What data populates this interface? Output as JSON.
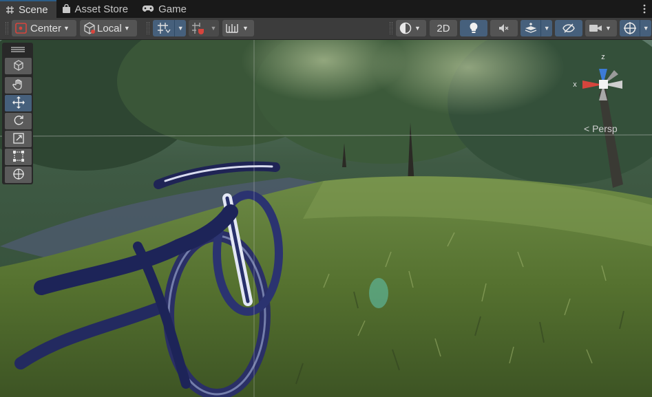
{
  "tabs": [
    {
      "label": "Scene",
      "icon": "grid-hash-icon",
      "active": true
    },
    {
      "label": "Asset Store",
      "icon": "shopping-bag-icon",
      "active": false
    },
    {
      "label": "Game",
      "icon": "gamepad-icon",
      "active": false
    }
  ],
  "toolbar": {
    "pivot_label": "Center",
    "space_label": "Local",
    "mode_2d_label": "2D"
  },
  "gizmo": {
    "axis_z_label": "z",
    "axis_x_label": "x",
    "projection_label": "< Persp"
  },
  "colors": {
    "selected": "#46607c",
    "axis_x": "#d6453d",
    "axis_y": "#7aba3a",
    "axis_z": "#3c7bd6"
  }
}
